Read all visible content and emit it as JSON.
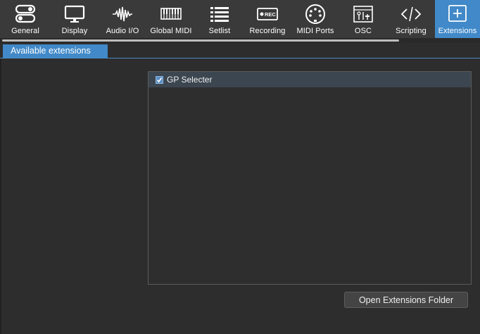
{
  "toolbar": {
    "items": [
      {
        "label": "General",
        "icon": "toggle-switches-icon"
      },
      {
        "label": "Display",
        "icon": "monitor-icon"
      },
      {
        "label": "Audio I/O",
        "icon": "waveform-icon"
      },
      {
        "label": "Global MIDI",
        "icon": "keyboard-icon"
      },
      {
        "label": "Setlist",
        "icon": "list-icon"
      },
      {
        "label": "Recording",
        "icon": "rec-icon"
      },
      {
        "label": "MIDI Ports",
        "icon": "midi-din-icon"
      },
      {
        "label": "OSC",
        "icon": "osc-icon"
      },
      {
        "label": "Scripting",
        "icon": "code-icon"
      },
      {
        "label": "Extensions",
        "icon": "plus-box-icon",
        "active": true
      }
    ],
    "rec_badge": "REC"
  },
  "tabs": {
    "available": "Available extensions"
  },
  "extensions": {
    "items": [
      {
        "label": "GP Selecter",
        "checked": true
      }
    ]
  },
  "buttons": {
    "open_folder": "Open Extensions Folder"
  },
  "colors": {
    "accent": "#4189c8",
    "toolbar_bg": "#3a3a3a",
    "panel_bg": "#2d2d2d",
    "selected_row": "#3c4650"
  }
}
